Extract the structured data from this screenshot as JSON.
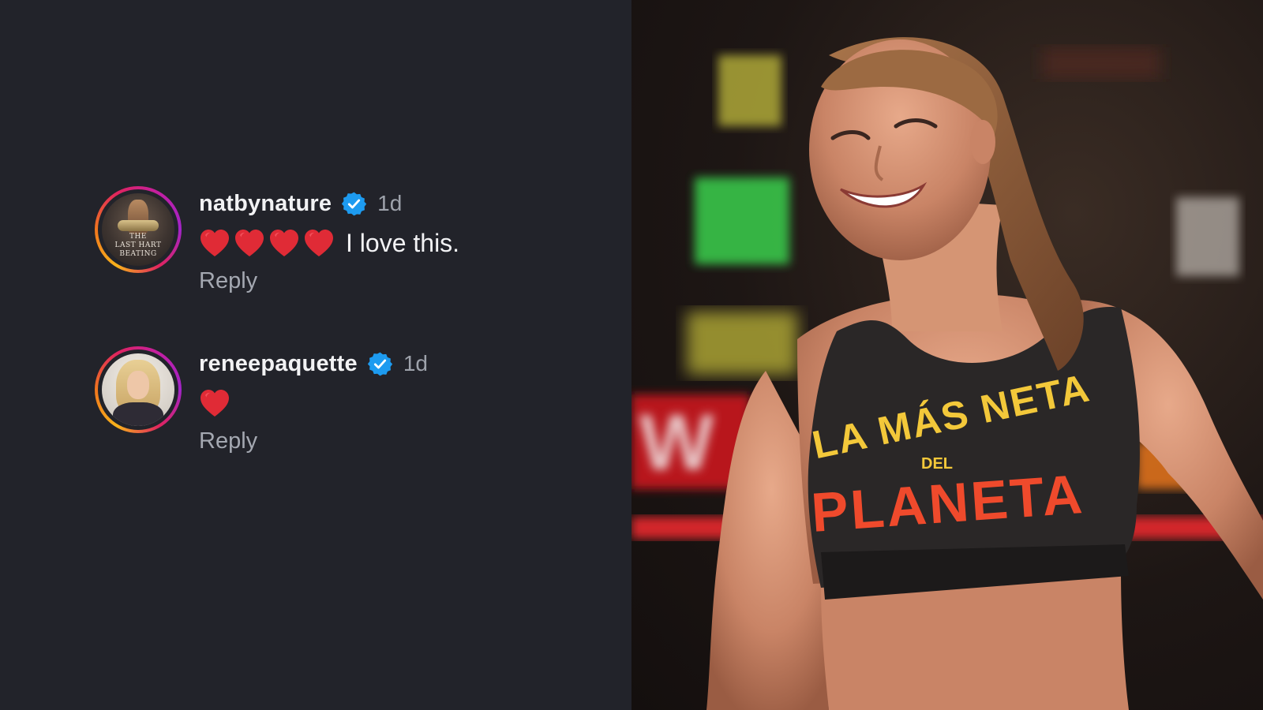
{
  "comments": [
    {
      "username": "natbynature",
      "verified": true,
      "time": "1d",
      "hearts": 4,
      "text": "I love this.",
      "reply_label": "Reply",
      "avatar_text": [
        "THE",
        "LAST HART",
        "BEATING"
      ]
    },
    {
      "username": "reneepaquette",
      "verified": true,
      "time": "1d",
      "hearts": 1,
      "text": "",
      "reply_label": "Reply"
    }
  ],
  "photo": {
    "shirt_line1": "LA MÁS NETA",
    "shirt_line2": "DEL",
    "shirt_line3": "PLANETA"
  },
  "colors": {
    "background": "#22232a",
    "verified": "#1d9bf0",
    "heart": "#e02b36"
  }
}
